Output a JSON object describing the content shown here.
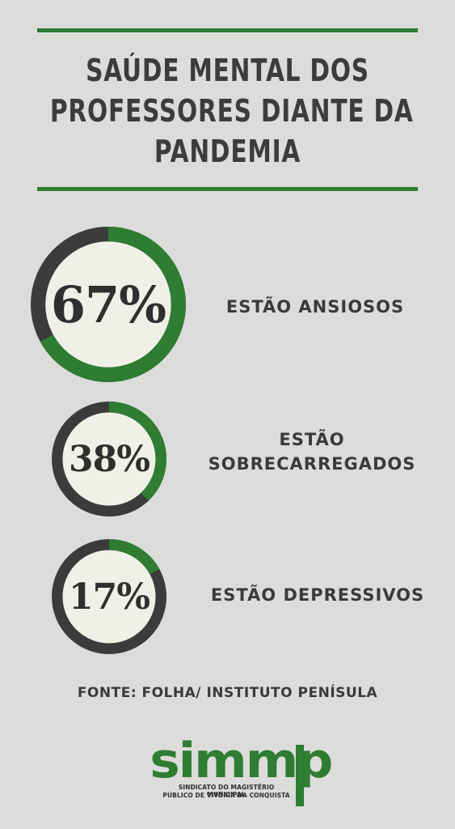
{
  "colors": {
    "green": "#2e7d32",
    "dark": "#3b3b3b",
    "disc": "#f1f0e8"
  },
  "title": {
    "line1": "SAÚDE MENTAL DOS",
    "line2": "PROFESSORES DIANTE DA",
    "line3": "PANDEMIA"
  },
  "stats": [
    {
      "label": "67%",
      "fraction": 0.67,
      "text": [
        "ESTÃO ANSIOSOS"
      ]
    },
    {
      "label": "38%",
      "fraction": 0.38,
      "text": [
        "ESTÃO",
        "SOBRECARREGADOS"
      ]
    },
    {
      "label": "17%",
      "fraction": 0.17,
      "text": [
        "ESTÃO DEPRESSIVOS"
      ]
    }
  ],
  "source": "FONTE: FOLHA/ INSTITUTO PENÍSULA",
  "logo": {
    "word": "simmp",
    "line1": "SINDICATO DO MAGISTÉRIO MUNICIPAL",
    "line2": "PÚBLICO DE VITÓRIA DA CONQUISTA"
  }
}
